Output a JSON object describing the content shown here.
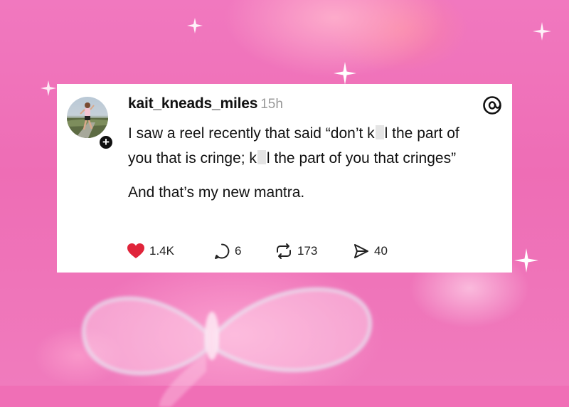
{
  "post": {
    "username": "kait_kneads_miles",
    "time": "15h",
    "text": {
      "p1_a": "I saw a reel recently that said “don’t k",
      "p1_b": "l the part of you that is cringe; k",
      "p1_c": "l the part of you that cringes”",
      "p2": "And that’s my new mantra."
    },
    "icons": {
      "logo": "threads-logo-icon",
      "follow": "plus-icon",
      "like": "heart-icon",
      "reply": "comment-icon",
      "repost": "repost-icon",
      "share": "send-icon"
    },
    "stats": {
      "likes": "1.4K",
      "replies": "6",
      "reposts": "173",
      "shares": "40"
    }
  },
  "colors": {
    "background": "#f06fb6",
    "heart": "#e0243a",
    "time": "#999999"
  }
}
